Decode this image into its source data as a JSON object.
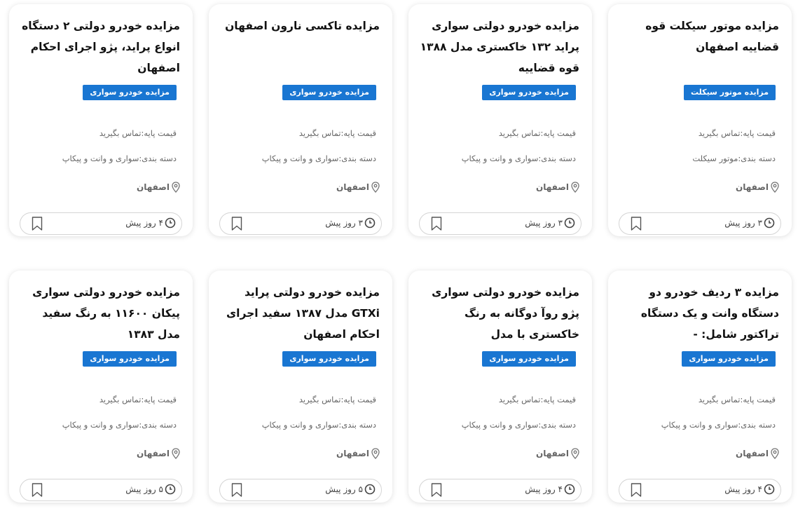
{
  "accent_color": "#1976d2",
  "icons": {
    "location": "location-pin-icon",
    "time": "clock-icon",
    "bookmark": "bookmark-icon"
  },
  "cards": [
    {
      "title": "مزایده موتور سیکلت قوه قضاییه اصفهان",
      "badge": "مزایده موتور سیکلت",
      "price": "قیمت پایه:تماس بگیرید",
      "category": "دسته بندی:موتور سیکلت",
      "location": "اصفهان",
      "time": "۳ روز پیش"
    },
    {
      "title": "مزایده خودرو دولتی سواری پراید ۱۳۲ خاکستری مدل ۱۳۸۸ قوه قضاییه",
      "badge": "مزایده خودرو سواری",
      "price": "قیمت پایه:تماس بگیرید",
      "category": "دسته بندی:سواری و وانت و پیکاپ",
      "location": "اصفهان",
      "time": "۳ روز پیش"
    },
    {
      "title": "مزایده تاکسی نارون اصفهان",
      "badge": "مزایده خودرو سواری",
      "price": "قیمت پایه:تماس بگیرید",
      "category": "دسته بندی:سواری و وانت و پیکاپ",
      "location": "اصفهان",
      "time": "۳ روز پیش"
    },
    {
      "title": "مزایده خودرو دولتی ۲ دستگاه انواع پراید، پژو اجرای احکام اصفهان",
      "badge": "مزایده خودرو سواری",
      "price": "قیمت پایه:تماس بگیرید",
      "category": "دسته بندی:سواری و وانت و پیکاپ",
      "location": "اصفهان",
      "time": "۴ روز پیش"
    },
    {
      "title": "مزایده ۳ ردیف خودرو دو دستگاه وانت و یک دستگاه تراکتور شامل: -",
      "badge": "مزایده خودرو سواری",
      "price": "قیمت پایه:تماس بگیرید",
      "category": "دسته بندی:سواری و وانت و پیکاپ",
      "location": "اصفهان",
      "time": "۴ روز پیش"
    },
    {
      "title": "مزایده خودرو دولتی سواری پژو روآ دوگانه به رنگ خاکستری با مدل",
      "badge": "مزایده خودرو سواری",
      "price": "قیمت پایه:تماس بگیرید",
      "category": "دسته بندی:سواری و وانت و پیکاپ",
      "location": "اصفهان",
      "time": "۴ روز پیش"
    },
    {
      "title": "مزایده خودرو دولتی پراید GTXi مدل ۱۳۸۷ سفید اجرای احکام اصفهان",
      "badge": "مزایده خودرو سواری",
      "price": "قیمت پایه:تماس بگیرید",
      "category": "دسته بندی:سواری و وانت و پیکاپ",
      "location": "اصفهان",
      "time": "۵ روز پیش"
    },
    {
      "title": "مزایده خودرو دولتی سواری پیکان ۱۱۶۰۰ به رنگ سفید مدل ۱۳۸۳",
      "badge": "مزایده خودرو سواری",
      "price": "قیمت پایه:تماس بگیرید",
      "category": "دسته بندی:سواری و وانت و پیکاپ",
      "location": "اصفهان",
      "time": "۵ روز پیش"
    }
  ]
}
